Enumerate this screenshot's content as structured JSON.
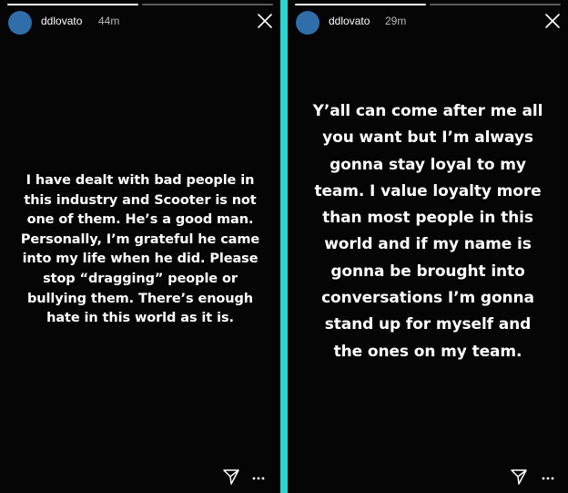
{
  "colors": {
    "divider": "#2fd3cf",
    "story_background": "#050505",
    "avatar": "#2f6ea8",
    "text": "#ffffff",
    "timestamp": "#b9b9b9"
  },
  "stories": [
    {
      "username": "ddlovato",
      "timestamp": "44m",
      "progress": {
        "segments": 2,
        "completed": 1
      },
      "text": "I have dealt with bad people in\nthis industry and Scooter is not\none of them. He’s a good man.\nPersonally, I’m grateful he came\ninto my life when he did.  Please\nstop “dragging” people or\nbullying them. There’s enough\nhate in this world as it is.",
      "icons": {
        "close": "close-icon",
        "share": "send-icon",
        "more": "more-icon"
      }
    },
    {
      "username": "ddlovato",
      "timestamp": "29m",
      "progress": {
        "segments": 2,
        "completed": 1
      },
      "text": "Y’all can come after me all\nyou want but I’m always\ngonna stay loyal to my\nteam. I value loyalty more\nthan most people in this\nworld and if my name is\ngonna be brought into\nconversations I’m gonna\nstand up for myself and\nthe ones on my team.",
      "icons": {
        "close": "close-icon",
        "share": "send-icon",
        "more": "more-icon"
      }
    }
  ]
}
